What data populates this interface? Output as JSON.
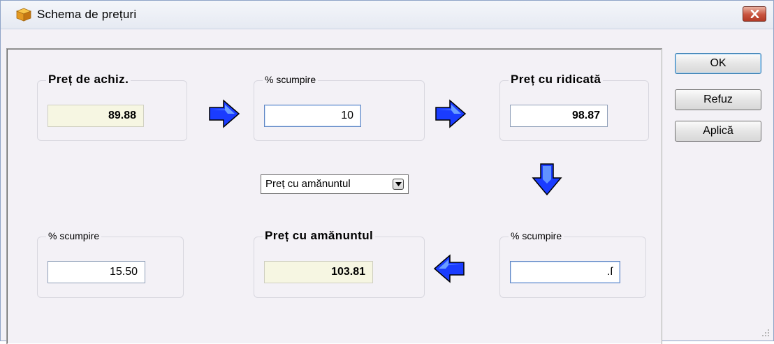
{
  "window": {
    "title": "Schema de prețuri",
    "icon": "package-icon",
    "close_icon": "close-icon"
  },
  "buttons": {
    "ok": "OK",
    "cancel": "Refuz",
    "apply": "Aplică"
  },
  "purchase": {
    "label": "Preț de achiz.",
    "value": "89.88"
  },
  "markup1": {
    "label": "% scumpire",
    "value": "10"
  },
  "wholesale": {
    "label": "Preț cu ridicată",
    "value": "98.87"
  },
  "markup_selector": {
    "selected": "Preț cu amănuntul"
  },
  "markup2": {
    "label": "% scumpire",
    "value": ".ſ"
  },
  "retail": {
    "label": "Preț cu amănuntul",
    "value": "103.81"
  },
  "markup3": {
    "label": "% scumpire",
    "value": "15.50"
  },
  "colors": {
    "arrow_fill": "#1a3cff",
    "arrow_highlight": "#7fb6ff",
    "readonly_bg": "#f6f6e2"
  }
}
